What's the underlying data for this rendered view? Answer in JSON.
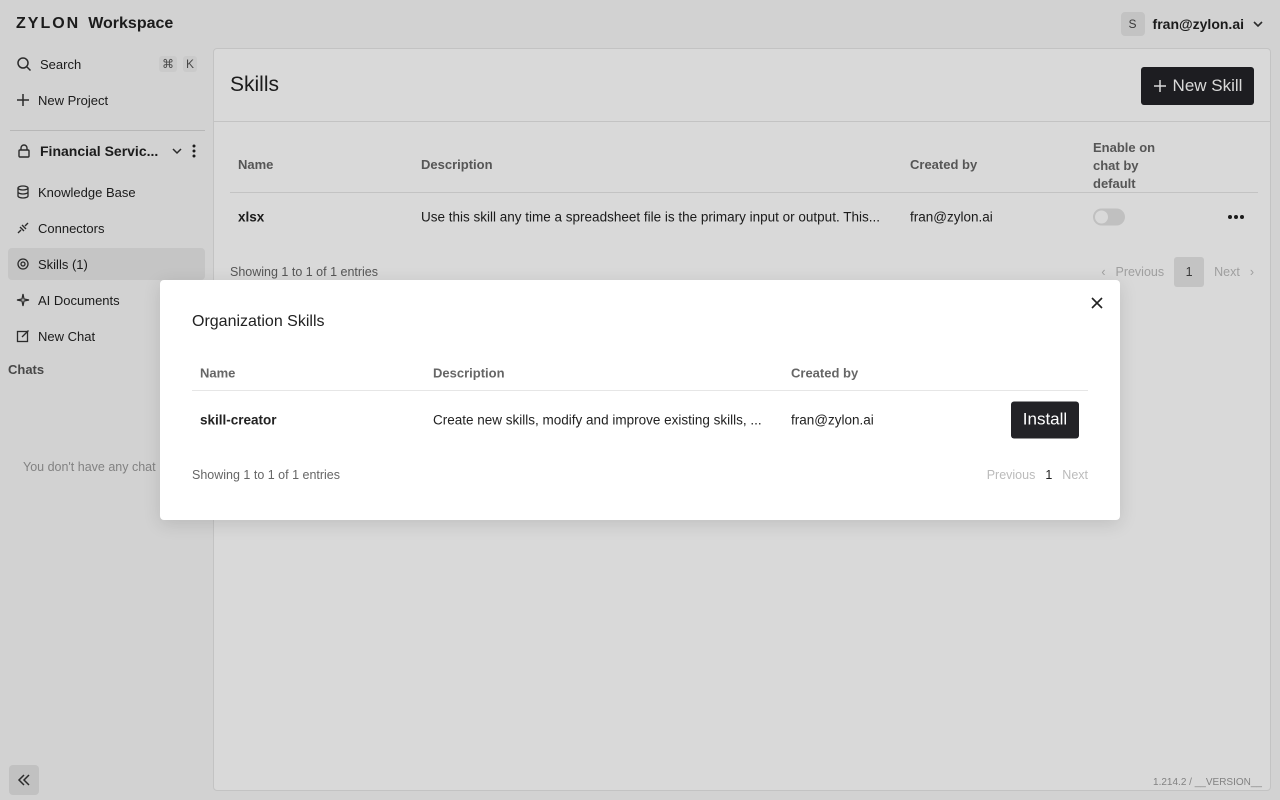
{
  "brand": {
    "logo": "ZYLON",
    "product": "Workspace"
  },
  "user": {
    "initial": "S",
    "email": "fran@zylon.ai"
  },
  "sidebar": {
    "search_label": "Search",
    "shortcut_cmd": "⌘",
    "shortcut_key": "K",
    "new_project_label": "New Project",
    "project_name": "Financial Servic...",
    "items": [
      {
        "label": "Knowledge Base",
        "icon": "database-icon"
      },
      {
        "label": "Connectors",
        "icon": "plug-icon"
      },
      {
        "label": "Skills (1)",
        "icon": "skills-icon",
        "active": true
      },
      {
        "label": "AI Documents",
        "icon": "sparkle-icon"
      },
      {
        "label": "New Chat",
        "icon": "edit-icon"
      }
    ],
    "chats_label": "Chats",
    "no_chats_text": "You don't have any chat"
  },
  "main": {
    "title": "Skills",
    "new_skill_label": "New Skill",
    "table": {
      "headers": {
        "name": "Name",
        "description": "Description",
        "created_by": "Created by",
        "enable_line1": "Enable on",
        "enable_line2": "chat by",
        "enable_line3": "default"
      },
      "rows": [
        {
          "name": "xlsx",
          "description": "Use this skill any time a spreadsheet file is the primary input or output. This...",
          "created_by": "fran@zylon.ai",
          "enabled": false
        }
      ]
    },
    "entries_text": "Showing 1 to 1 of 1 entries",
    "pager": {
      "prev": "Previous",
      "page": "1",
      "next": "Next"
    },
    "version": "1.214.2 / __VERSION__"
  },
  "modal": {
    "title": "Organization Skills",
    "headers": {
      "name": "Name",
      "description": "Description",
      "created_by": "Created by"
    },
    "rows": [
      {
        "name": "skill-creator",
        "description": "Create new skills, modify and improve existing skills, ...",
        "created_by": "fran@zylon.ai",
        "action": "Install"
      }
    ],
    "entries_text": "Showing 1 to 1 of 1 entries",
    "pager": {
      "prev": "Previous",
      "page": "1",
      "next": "Next"
    }
  }
}
